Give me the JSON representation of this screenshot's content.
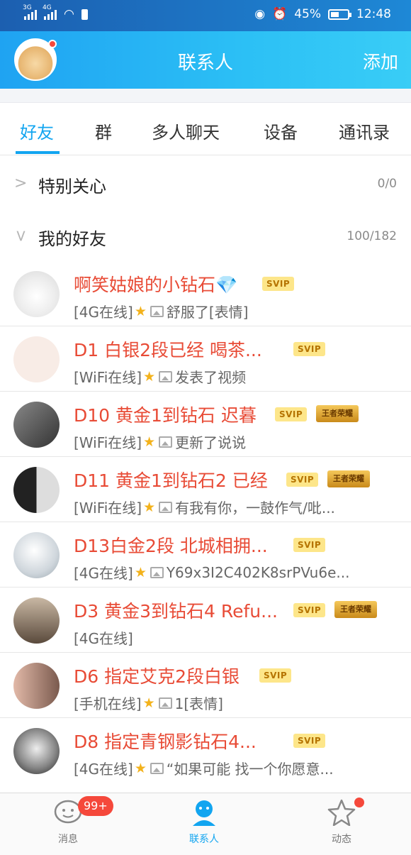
{
  "status_bar": {
    "net1": "3G",
    "net2": "4G",
    "battery_pct": "45%",
    "time": "12:48"
  },
  "header": {
    "title": "联系人",
    "add_label": "添加"
  },
  "tabs": [
    {
      "label": "好友"
    },
    {
      "label": "群"
    },
    {
      "label": "多人聊天"
    },
    {
      "label": "设备"
    },
    {
      "label": "通讯录"
    }
  ],
  "groups": [
    {
      "name": "特别关心",
      "count": "0/0",
      "expanded": false
    },
    {
      "name": "我的好友",
      "count": "100/182",
      "expanded": true
    }
  ],
  "friends": [
    {
      "name": "啊笑姑娘的小钻石💎",
      "status": "[4G在线]",
      "activity": "舒服了[表情]",
      "svip": "SVIP",
      "game_badge": false
    },
    {
      "name": "D1 白银2段已经 喝茶...",
      "status": "[WiFi在线]",
      "activity": "发表了视频",
      "svip": "SVIP",
      "game_badge": false
    },
    {
      "name": "D10 黄金1到钻石 迟暮",
      "status": "[WiFi在线]",
      "activity": "更新了说说",
      "svip": "SVIP",
      "game_badge": true
    },
    {
      "name": "D11 黄金1到钻石2 已经",
      "status": "[WiFi在线]",
      "activity": "有我有你，一鼓作气/吡...",
      "svip": "SVIP",
      "game_badge": true
    },
    {
      "name": "D13白金2段 北城相拥...",
      "status": "[4G在线]",
      "activity": "Y69x3I2C402K8srPVu6e...",
      "svip": "SVIP",
      "game_badge": false
    },
    {
      "name": "D3 黄金3到钻石4 Refu...",
      "status": "[4G在线]",
      "activity": "",
      "svip": "SVIP",
      "game_badge": true
    },
    {
      "name": "D6 指定艾克2段白银",
      "status": "[手机在线]",
      "activity": "1[表情]",
      "svip": "SVIP",
      "game_badge": false
    },
    {
      "name": "D8 指定青钢影钻石4...",
      "status": "[4G在线]",
      "activity": "“如果可能 找一个你愿意...",
      "svip": "SVIP",
      "game_badge": false
    }
  ],
  "game_badge_text": "王者荣耀",
  "bottom_nav": [
    {
      "label": "消息",
      "badge": "99+"
    },
    {
      "label": "联系人"
    },
    {
      "label": "动态"
    }
  ],
  "colors": {
    "accent": "#12a5f0",
    "name_red": "#e84b36",
    "badge_red": "#f5483b"
  }
}
